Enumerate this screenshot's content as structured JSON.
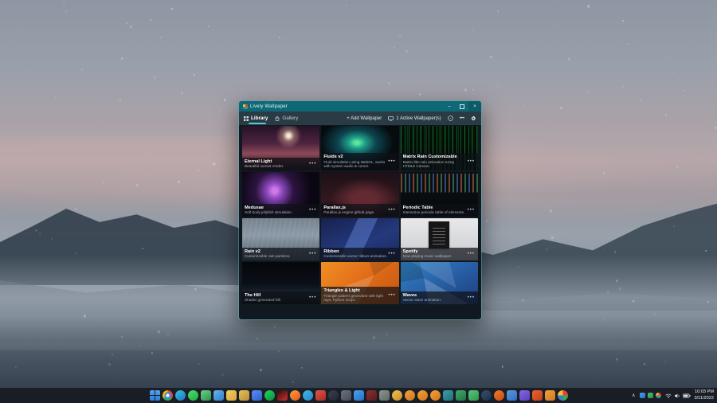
{
  "window": {
    "title": "Lively Wallpaper",
    "controls": {
      "minimize": "–",
      "close": "×"
    },
    "tabs": [
      {
        "label": "Library",
        "active": true
      },
      {
        "label": "Gallery",
        "active": false
      }
    ],
    "toolbar": {
      "add_label": "+ Add Wallpaper",
      "active_label": "1 Active Wallpaper(s)",
      "more_label": "•••"
    },
    "tiles_more": "•••",
    "tiles": [
      {
        "title": "Eternal Light",
        "subtitle": "Beautiful sunset render."
      },
      {
        "title": "Fluids v2",
        "subtitle": "Fluid simulation using WebGL, works with system audio & cursor."
      },
      {
        "title": "Matrix Rain Customizable",
        "subtitle": "Matrix like rain animation using HTML5 Canvas."
      },
      {
        "title": "Medusae",
        "subtitle": "Soft body jellyfish simulation."
      },
      {
        "title": "Parallax.js",
        "subtitle": "Parallax.js engine github page."
      },
      {
        "title": "Periodic Table",
        "subtitle": "Interactive periodic table of elements."
      },
      {
        "title": "Rain v2",
        "subtitle": "Customizable rain particles."
      },
      {
        "title": "Ribbon",
        "subtitle": "Customizable vector ribbon animation."
      },
      {
        "title": "Spotify",
        "subtitle": "Now playing music wallpaper."
      },
      {
        "title": "The Hill",
        "subtitle": "Shader generated hill."
      },
      {
        "title": "Triangles & Light",
        "subtitle": "Triangle pattern generated with light rays. Python script."
      },
      {
        "title": "Waves",
        "subtitle": "Vector wave animation."
      }
    ]
  },
  "taskbar": {
    "icons": [
      {
        "name": "start-button",
        "shape": "special-start",
        "c1": "#4fa3ef",
        "c2": "#2f7fd6"
      },
      {
        "name": "chrome-icon",
        "shape": "special-chrome",
        "c1": "#ea4335",
        "c2": "#34a853"
      },
      {
        "name": "edge-icon",
        "shape": "circle",
        "c1": "#35c7d6",
        "c2": "#1c6fc9"
      },
      {
        "name": "whatsapp-icon",
        "shape": "circle",
        "c1": "#4ae06a",
        "c2": "#1faf45"
      },
      {
        "name": "notes-app-icon",
        "shape": "square",
        "c1": "#6fd08a",
        "c2": "#2e8f4d"
      },
      {
        "name": "photos-app-icon",
        "shape": "square",
        "c1": "#6ab4ec",
        "c2": "#2f7fc6"
      },
      {
        "name": "file-explorer-icon",
        "shape": "square",
        "c1": "#f4ce66",
        "c2": "#d9a43a"
      },
      {
        "name": "folder-app-icon",
        "shape": "square",
        "c1": "#e6c05c",
        "c2": "#b98f35"
      },
      {
        "name": "todo-app-icon",
        "shape": "square",
        "c1": "#5a8cf0",
        "c2": "#2f5fd0"
      },
      {
        "name": "spotify-icon",
        "shape": "circle",
        "c1": "#1ed760",
        "c2": "#0f8c3c"
      },
      {
        "name": "netflix-icon",
        "shape": "square",
        "c1": "#2a0d0d",
        "c2": "#d0312d"
      },
      {
        "name": "firefox-icon",
        "shape": "circle",
        "c1": "#ff9b3e",
        "c2": "#e05a1f"
      },
      {
        "name": "telegram-icon",
        "shape": "circle",
        "c1": "#49b4e6",
        "c2": "#1f8ac9"
      },
      {
        "name": "red-app-icon",
        "shape": "square",
        "c1": "#e05548",
        "c2": "#a62c24"
      },
      {
        "name": "moon-app-icon",
        "shape": "circle",
        "c1": "#3a4150",
        "c2": "#20252f"
      },
      {
        "name": "gray-app-icon",
        "shape": "square",
        "c1": "#6b7380",
        "c2": "#454c58"
      },
      {
        "name": "vscode-icon",
        "shape": "square",
        "c1": "#4aa0e8",
        "c2": "#2472c8"
      },
      {
        "name": "dark-red-app-icon",
        "shape": "square",
        "c1": "#8a3030",
        "c2": "#5a1c1c"
      },
      {
        "name": "utility-app-icon",
        "shape": "square",
        "c1": "#8c968e",
        "c2": "#5e6a62"
      },
      {
        "name": "emoji-app-icon",
        "shape": "circle",
        "c1": "#f2c24e",
        "c2": "#c98a2a"
      },
      {
        "name": "orange-app-1-icon",
        "shape": "circle",
        "c1": "#f2a23c",
        "c2": "#d07518"
      },
      {
        "name": "orange-app-2-icon",
        "shape": "circle",
        "c1": "#f2a23c",
        "c2": "#d07518"
      },
      {
        "name": "orange-app-3-icon",
        "shape": "circle",
        "c1": "#f2a23c",
        "c2": "#d07518"
      },
      {
        "name": "teams-app-icon",
        "shape": "square",
        "c1": "#3aa0a8",
        "c2": "#1f7078"
      },
      {
        "name": "excel-icon",
        "shape": "square",
        "c1": "#3fae68",
        "c2": "#217346"
      },
      {
        "name": "green-mini-app-icon",
        "shape": "square",
        "c1": "#58c878",
        "c2": "#2f9650"
      },
      {
        "name": "navy-app-icon",
        "shape": "circle",
        "c1": "#35506e",
        "c2": "#1d3048"
      },
      {
        "name": "flame-app-icon",
        "shape": "circle",
        "c1": "#f07a2e",
        "c2": "#c44c12"
      },
      {
        "name": "blue-mini-app-icon",
        "shape": "square",
        "c1": "#5a9ae0",
        "c2": "#2f6fc0"
      },
      {
        "name": "purple-app-icon",
        "shape": "square",
        "c1": "#8468e0",
        "c2": "#5a3fc0"
      },
      {
        "name": "powerpoint-icon",
        "shape": "square",
        "c1": "#e8642e",
        "c2": "#c43e1c"
      },
      {
        "name": "orange-bar-app-icon",
        "shape": "square",
        "c1": "#f0a040",
        "c2": "#d0781e"
      },
      {
        "name": "lively-taskbar-icon",
        "shape": "special-lively",
        "c1": "#e8413c",
        "c2": "#3a7bd5"
      }
    ],
    "tray": {
      "chevron": "∧",
      "mini_icons": [
        {
          "name": "onedrive-tray-icon",
          "c1": "#4aa0e8",
          "c2": "#2472c8"
        },
        {
          "name": "green-tray-icon",
          "c1": "#4ac06a",
          "c2": "#2a9048"
        },
        {
          "name": "lively-tray-icon",
          "c1": "#e8413c",
          "c2": "#3a7bd5"
        }
      ],
      "time": "10:03 PM",
      "date": "3/11/2022"
    }
  },
  "colors": {
    "titlebar": "#0e6876",
    "accent_underline": "#58c6d8",
    "toolbar_bg": "#2a3b45",
    "content_bg": "#10191f",
    "taskbar_bg": "#181c24"
  }
}
